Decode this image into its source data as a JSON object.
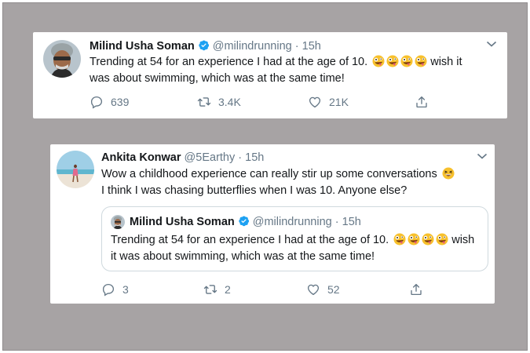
{
  "tweet_main": {
    "name": "Milind Usha Soman",
    "handle": "@milindrunning",
    "separator": "·",
    "time": "15h",
    "text_line1": "Trending at 54 for an experience I had at the age of 10.",
    "text_line1_tail": "wish it",
    "text_line2": "was about swimming, which was at the same time!",
    "emoji_count": 4,
    "replies": "639",
    "retweets": "3.4K",
    "likes": "21K"
  },
  "tweet_reply": {
    "name": "Ankita Konwar",
    "handle": "@5Earthy",
    "separator": "·",
    "time": "15h",
    "text_line1": "Wow a childhood experience can really stir up some conversations",
    "text_line2": "I think I was chasing butterflies when I was 10. Anyone else?",
    "replies": "3",
    "retweets": "2",
    "likes": "52",
    "quoted": {
      "name": "Milind Usha Soman",
      "handle": "@milindrunning",
      "separator": "·",
      "time": "15h",
      "text_line1": "Trending at 54 for an experience I had at the age of 10.",
      "text_line1_tail": "wish",
      "text_line2": "it was about swimming, which was at the same time!"
    }
  },
  "colors": {
    "background": "#a7a3a4",
    "card": "#ffffff",
    "text": "#14171a",
    "secondary_text": "#657786",
    "verified_blue": "#1da1f2",
    "emoji_yellow": "#f7c02c"
  },
  "icons": {
    "reply": "reply-icon",
    "retweet": "retweet-icon",
    "like": "heart-icon",
    "share": "share-icon",
    "verified": "verified-badge-icon",
    "more": "chevron-down-icon",
    "emoji_zany": "zany-face-emoji",
    "emoji_grin": "grinning-squinting-face-emoji"
  }
}
